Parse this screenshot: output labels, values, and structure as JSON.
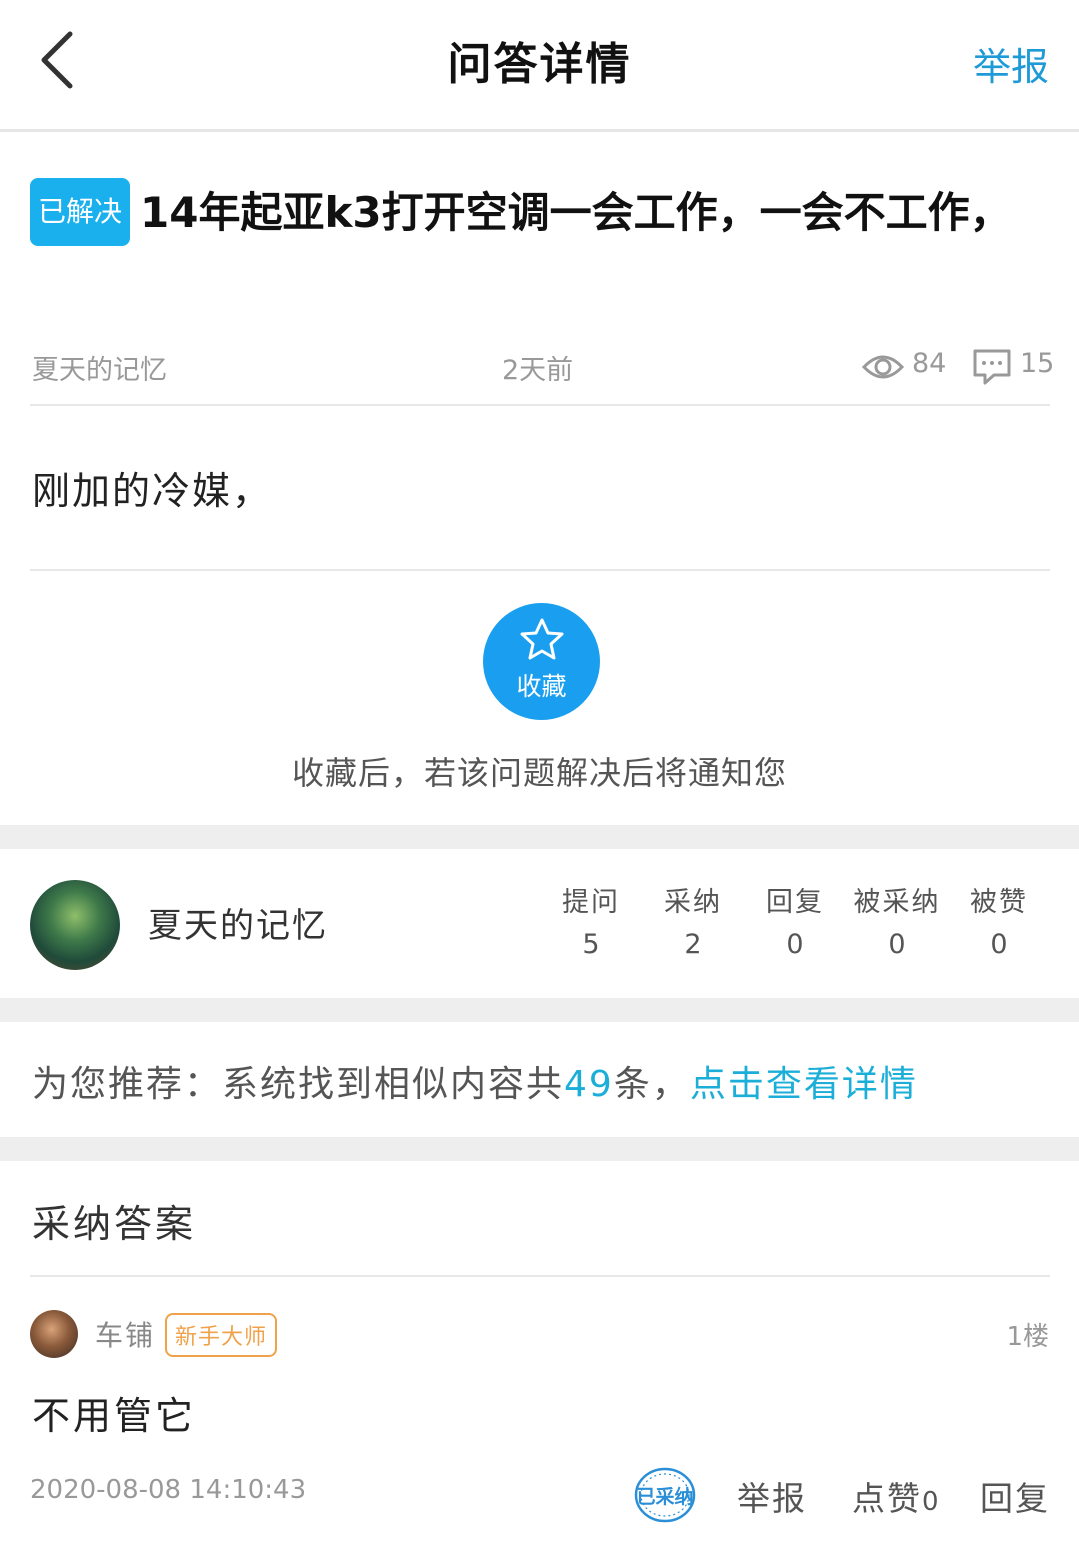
{
  "header": {
    "title": "问答详情",
    "report_label": "举报"
  },
  "question": {
    "status_badge": "已解决",
    "title": "14年起亚k3打开空调一会工作，一会不工作，",
    "author": "夏天的记忆",
    "time_ago": "2天前",
    "views": "84",
    "comments": "15",
    "body": "刚加的冷媒，"
  },
  "favorite": {
    "button_label": "收藏",
    "hint": "收藏后，若该问题解决后将通知您"
  },
  "asker_profile": {
    "name": "夏天的记忆",
    "stats": [
      {
        "label": "提问",
        "value": "5"
      },
      {
        "label": "采纳",
        "value": "2"
      },
      {
        "label": "回复",
        "value": "0"
      },
      {
        "label": "被采纳",
        "value": "0"
      },
      {
        "label": "被赞",
        "value": "0"
      }
    ]
  },
  "recommend": {
    "prefix": "为您推荐：系统找到相似内容共",
    "count": "49",
    "suffix": "条，",
    "link": "点击查看详情"
  },
  "accepted_answer": {
    "section_title": "采纳答案",
    "user": "车铺",
    "rank_badge": "新手大师",
    "floor": "1楼",
    "body": "不用管它",
    "timestamp": "2020-08-08 14:10:43",
    "accepted_stamp": "已采纳",
    "report_label": "举报",
    "like_label": "点赞",
    "like_count": "0",
    "reply_label": "回复"
  },
  "colors": {
    "accent": "#1e9bd7",
    "badge_blue": "#1ab0ee",
    "rank_orange": "#f0a24b",
    "muted_text": "#999999"
  }
}
